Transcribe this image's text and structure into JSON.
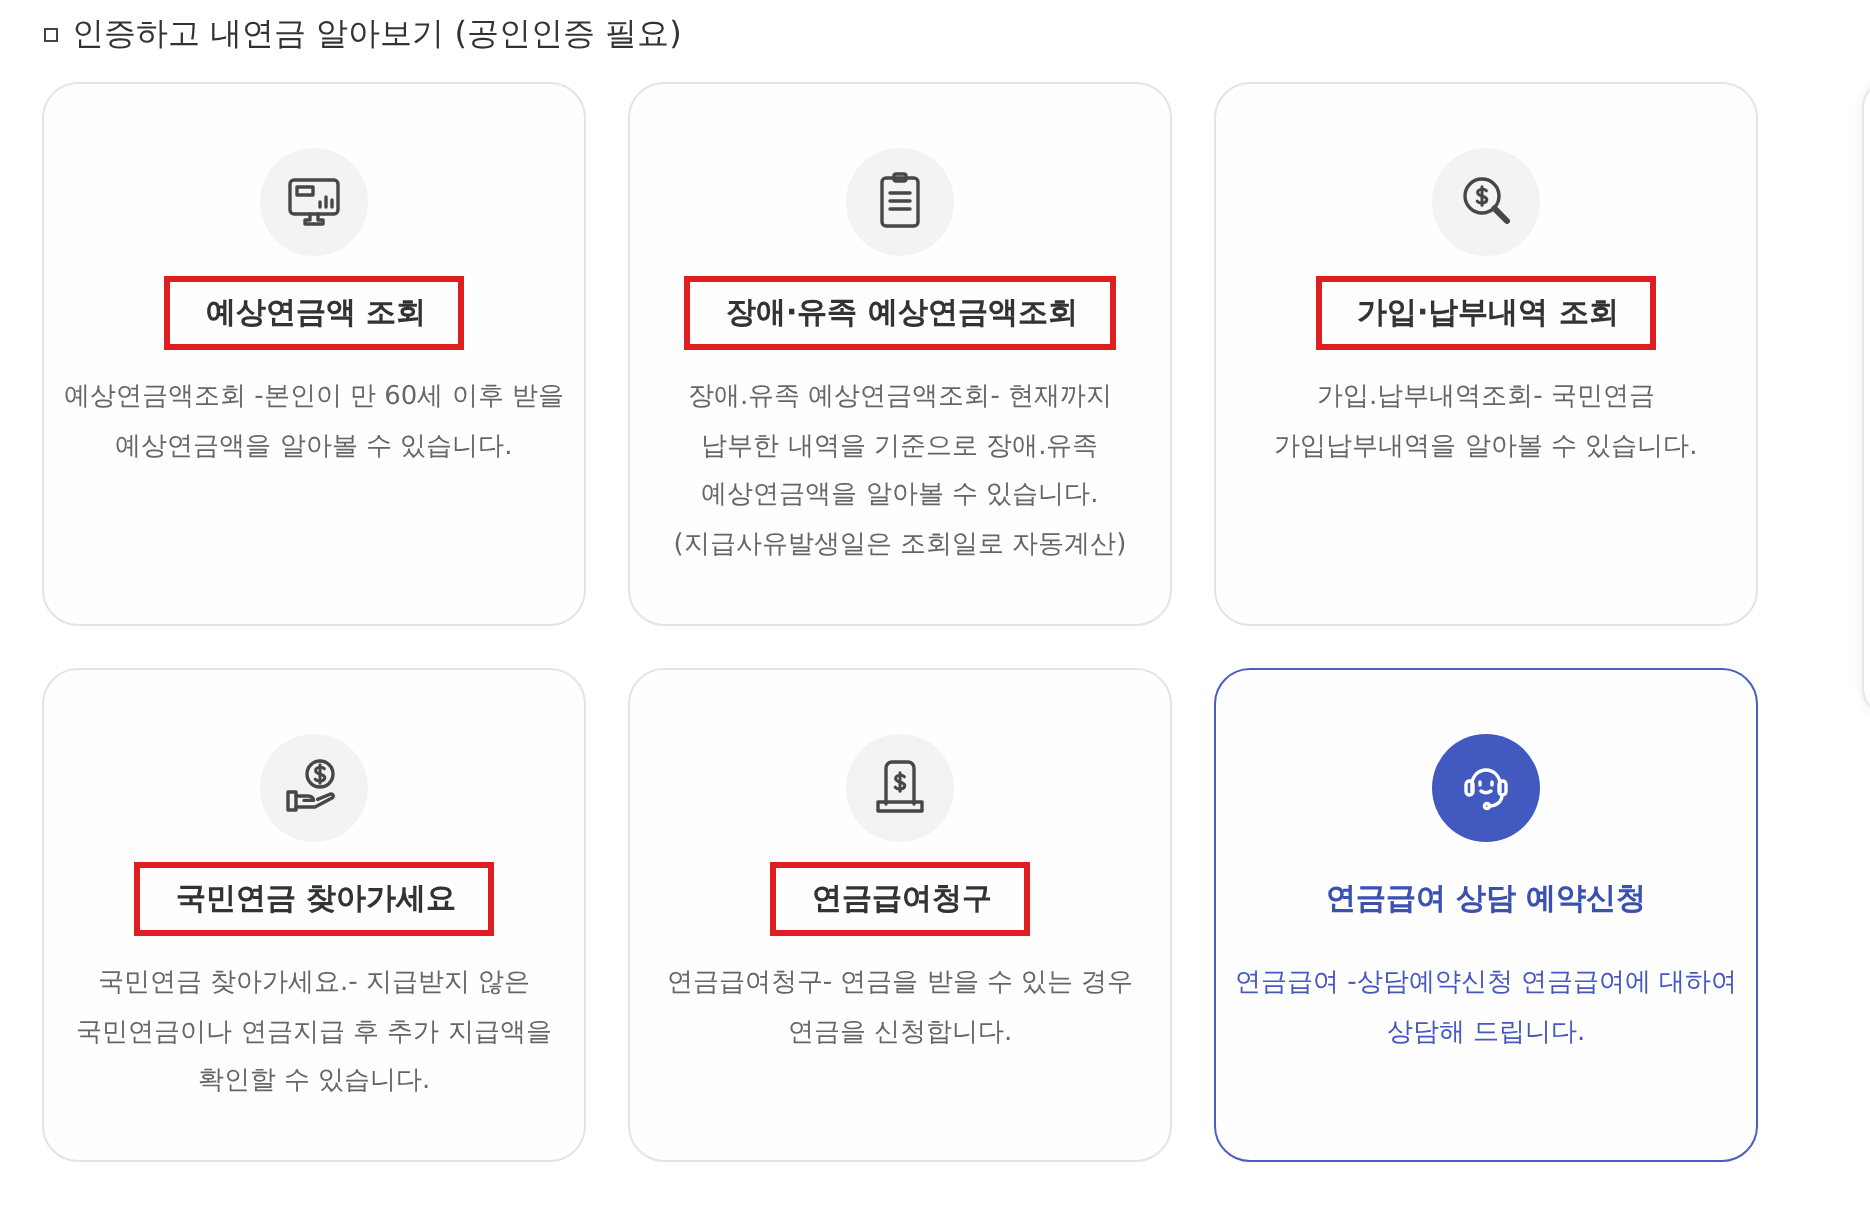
{
  "section": {
    "title": "인증하고 내연금 알아보기 (공인인증 필요)"
  },
  "cards": [
    {
      "title": "예상연금액 조회",
      "description": [
        "예상연금액조회 -본인이 만 60세 이후 받을",
        "예상연금액을 알아볼 수 있습니다."
      ],
      "highlighted": true,
      "active": false
    },
    {
      "title": "장애·유족 예상연금액조회",
      "description": [
        "장애.유족 예상연금액조회- 현재까지",
        "납부한 내역을 기준으로 장애.유족",
        "예상연금액을 알아볼 수 있습니다.",
        "(지급사유발생일은 조회일로 자동계산)"
      ],
      "highlighted": true,
      "active": false
    },
    {
      "title": "가입·납부내역 조회",
      "description": [
        "가입.납부내역조회- 국민연금",
        "가입납부내역을 알아볼 수 있습니다."
      ],
      "highlighted": true,
      "active": false
    },
    {
      "title": "국민연금 찾아가세요",
      "description": [
        "국민연금 찾아가세요.- 지급받지 않은",
        "국민연금이나 연금지급 후 추가 지급액을",
        "확인할 수 있습니다."
      ],
      "highlighted": true,
      "active": false
    },
    {
      "title": "연금급여청구",
      "description": [
        "연금급여청구- 연금을 받을 수 있는 경우",
        "연금을 신청합니다."
      ],
      "highlighted": true,
      "active": false
    },
    {
      "title": "연금급여 상담 예약신청",
      "description": [
        "연금급여 -상담예약신청 연금급여에 대하여",
        "상담해 드립니다."
      ],
      "highlighted": false,
      "active": true
    }
  ]
}
